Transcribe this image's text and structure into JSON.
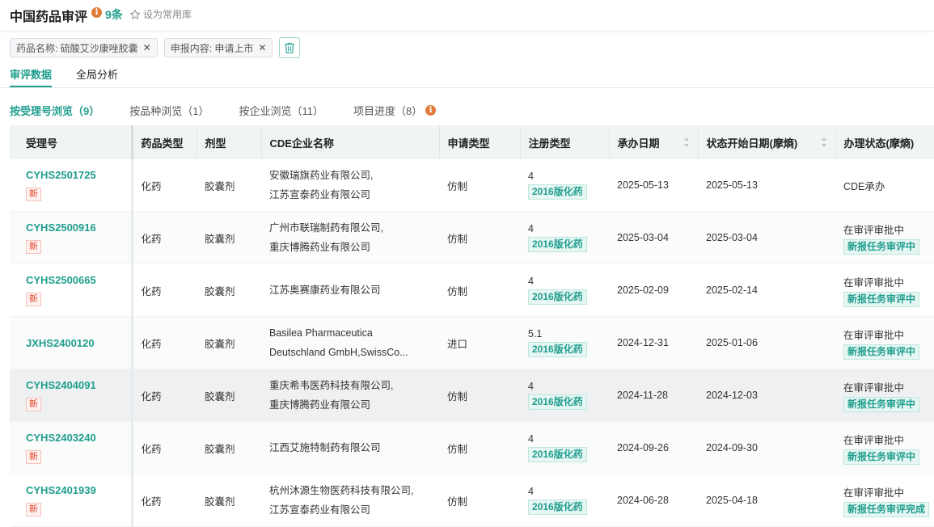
{
  "header": {
    "title": "中国药品审评",
    "count": "9条",
    "favorite_label": "设为常用库"
  },
  "filters": [
    {
      "label": "药品名称: 硫酸艾沙康唑胶囊"
    },
    {
      "label": "申报内容: 申请上市"
    }
  ],
  "tabs": [
    {
      "label": "审评数据",
      "active": true
    },
    {
      "label": "全局分析",
      "active": false
    }
  ],
  "subtabs": [
    {
      "label": "按受理号浏览（9）",
      "active": true
    },
    {
      "label": "按品种浏览（1）",
      "active": false
    },
    {
      "label": "按企业浏览（11）",
      "active": false
    },
    {
      "label": "项目进度（8）",
      "active": false
    }
  ],
  "columns": [
    "受理号",
    "药品类型",
    "剂型",
    "CDE企业名称",
    "申请类型",
    "注册类型",
    "承办日期",
    "状态开始日期(摩熵)",
    "办理状态(摩熵)"
  ],
  "rows": [
    {
      "id": "CYHS2501725",
      "new": "新",
      "drug_type": "化药",
      "form": "胶囊剂",
      "company1": "安徽瑞旗药业有限公司,",
      "company2": "江苏宣泰药业有限公司",
      "app_type": "仿制",
      "reg_num": "4",
      "reg_tag": "2016版化药",
      "accept_date": "2025-05-13",
      "status_date": "2025-05-13",
      "status": "CDE承办",
      "status_tag": ""
    },
    {
      "id": "CYHS2500916",
      "new": "新",
      "drug_type": "化药",
      "form": "胶囊剂",
      "company1": "广州市联瑞制药有限公司,",
      "company2": "重庆博腾药业有限公司",
      "app_type": "仿制",
      "reg_num": "4",
      "reg_tag": "2016版化药",
      "accept_date": "2025-03-04",
      "status_date": "2025-03-04",
      "status": "在审评审批中",
      "status_tag": "新报任务审评中"
    },
    {
      "id": "CYHS2500665",
      "new": "新",
      "drug_type": "化药",
      "form": "胶囊剂",
      "company1": "江苏奥赛康药业有限公司",
      "company2": "",
      "app_type": "仿制",
      "reg_num": "4",
      "reg_tag": "2016版化药",
      "accept_date": "2025-02-09",
      "status_date": "2025-02-14",
      "status": "在审评审批中",
      "status_tag": "新报任务审评中"
    },
    {
      "id": "JXHS2400120",
      "new": "",
      "drug_type": "化药",
      "form": "胶囊剂",
      "company1": "Basilea Pharmaceutica",
      "company2": "Deutschland GmbH,SwissCo...",
      "app_type": "进口",
      "reg_num": "5.1",
      "reg_tag": "2016版化药",
      "accept_date": "2024-12-31",
      "status_date": "2025-01-06",
      "status": "在审评审批中",
      "status_tag": "新报任务审评中"
    },
    {
      "id": "CYHS2404091",
      "new": "新",
      "drug_type": "化药",
      "form": "胶囊剂",
      "company1": "重庆希韦医药科技有限公司,",
      "company2": "重庆博腾药业有限公司",
      "app_type": "仿制",
      "reg_num": "4",
      "reg_tag": "2016版化药",
      "accept_date": "2024-11-28",
      "status_date": "2024-12-03",
      "status": "在审评审批中",
      "status_tag": "新报任务审评中"
    },
    {
      "id": "CYHS2403240",
      "new": "新",
      "drug_type": "化药",
      "form": "胶囊剂",
      "company1": "江西艾施特制药有限公司",
      "company2": "",
      "app_type": "仿制",
      "reg_num": "4",
      "reg_tag": "2016版化药",
      "accept_date": "2024-09-26",
      "status_date": "2024-09-30",
      "status": "在审评审批中",
      "status_tag": "新报任务审评中"
    },
    {
      "id": "CYHS2401939",
      "new": "新",
      "drug_type": "化药",
      "form": "胶囊剂",
      "company1": "杭州沐源生物医药科技有限公司,",
      "company2": "江苏宣泰药业有限公司",
      "app_type": "仿制",
      "reg_num": "4",
      "reg_tag": "2016版化药",
      "accept_date": "2024-06-28",
      "status_date": "2025-04-18",
      "status": "在审评审批中",
      "status_tag": "新报任务审评完成"
    }
  ]
}
